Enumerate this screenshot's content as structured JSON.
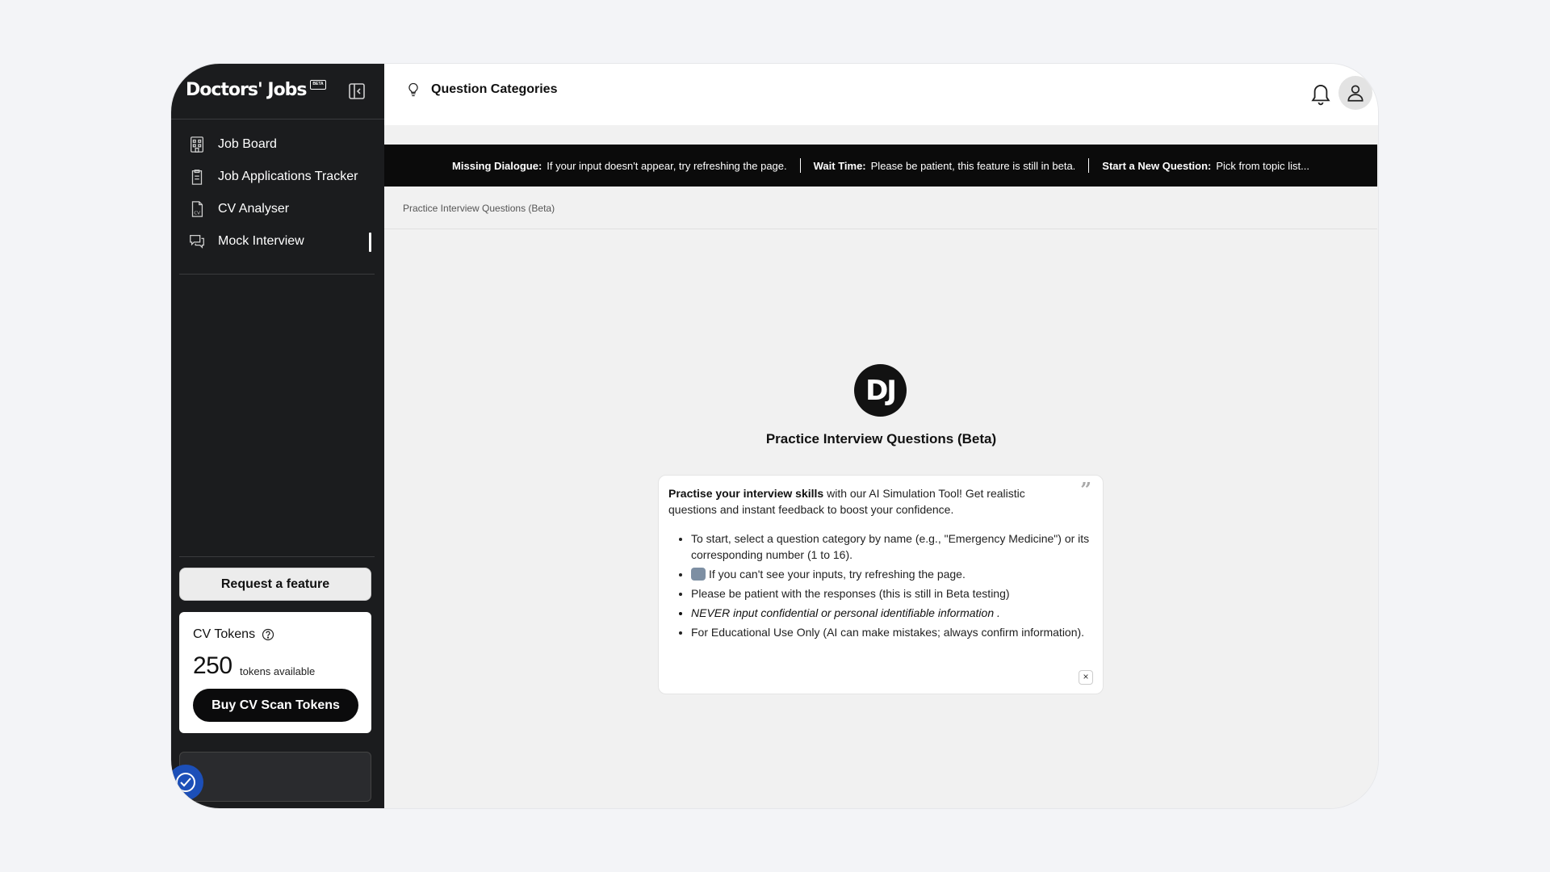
{
  "sidebar": {
    "logo": "Doctors' Jobs",
    "beta_tag": "BETA",
    "nav": [
      {
        "label": "Job Board",
        "icon": "job-board-icon"
      },
      {
        "label": "Job Applications Tracker",
        "icon": "tracker-icon"
      },
      {
        "label": "CV Analyser",
        "icon": "cv-icon"
      },
      {
        "label": "Mock Interview",
        "icon": "chat-icon",
        "active": true
      }
    ],
    "request_feature": "Request a feature",
    "tokens": {
      "title": "CV Tokens",
      "count": "250",
      "unit": "tokens available",
      "buy_label": "Buy CV Scan Tokens"
    }
  },
  "topbar": {
    "title": "Question Categories"
  },
  "banner": {
    "items": [
      {
        "key": "Missing Dialogue:",
        "text": "If your input doesn't appear, try refreshing the page."
      },
      {
        "key": "Wait Time:",
        "text": "Please be patient, this feature is still in beta."
      },
      {
        "key": "Start a New Question:",
        "text": "Pick from topic list..."
      }
    ]
  },
  "breadcrumb": "Practice Interview Questions (Beta)",
  "main": {
    "logo_text": "DJ",
    "heading": "Practice Interview Questions (Beta)",
    "card": {
      "intro_bold": "Practise your interview skills",
      "intro_rest": " with our AI Simulation Tool! Get realistic questions and instant feedback to boost your confidence.",
      "bullets": [
        "To start, select a question category by name (e.g., \"Emergency Medicine\") or its corresponding number (1 to 16).",
        "If you can't see your inputs, try refreshing the page.",
        "Please be patient with the responses (this is still in Beta testing)",
        "NEVER input confidential or personal identifiable information .",
        "For Educational Use Only (AI can make mistakes; always confirm information)."
      ],
      "close": "×"
    }
  }
}
